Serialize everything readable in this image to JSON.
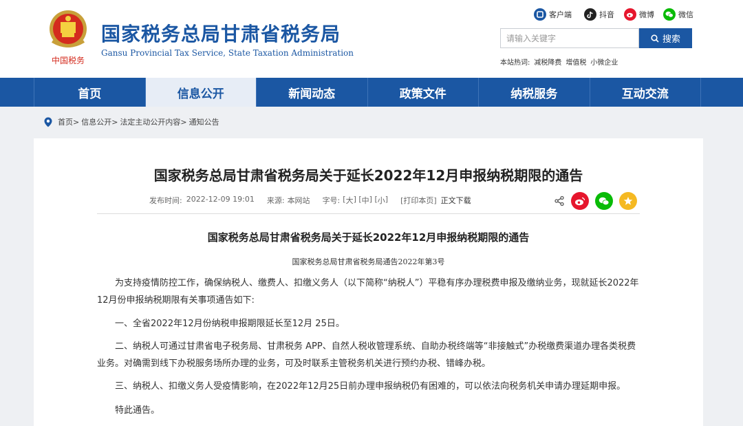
{
  "header": {
    "title_cn": "国家税务总局甘肃省税务局",
    "title_en": "Gansu Provincial Tax Service, State Taxation Administration",
    "logo_caption": "中国税务",
    "social": [
      {
        "label": "客户端",
        "icon": "client-icon",
        "color": "#1b57a3"
      },
      {
        "label": "抖音",
        "icon": "douyin-icon",
        "color": "#222222"
      },
      {
        "label": "微博",
        "icon": "weibo-icon",
        "color": "#e6162d"
      },
      {
        "label": "微信",
        "icon": "wechat-icon",
        "color": "#09bb07"
      }
    ],
    "search": {
      "placeholder": "请输入关键字",
      "button_label": "搜索"
    },
    "hot": {
      "label": "本站热词:",
      "words": [
        "减税降费",
        "增值税",
        "小微企业"
      ]
    }
  },
  "nav": {
    "items": [
      "首页",
      "信息公开",
      "新闻动态",
      "政策文件",
      "纳税服务",
      "互动交流"
    ],
    "active_index": 1
  },
  "breadcrumb": [
    "首页>",
    "信息公开>",
    "法定主动公开内容>",
    "通知公告"
  ],
  "article": {
    "title": "国家税务总局甘肃省税务局关于延长2022年12月申报纳税期限的通告",
    "meta": {
      "date_label": "发布时间:",
      "date": "2022-12-09 19:01",
      "source_label": "来源:",
      "source": "本网站",
      "font_label": "字号:",
      "font_open": "[",
      "font_large": "大",
      "font_sep1": "] [",
      "font_medium": "中",
      "font_sep2": "] [",
      "font_small": "小",
      "font_close": "]",
      "print": "[打印本页]",
      "download": "正文下载"
    },
    "doc_title": "国家税务总局甘肃省税务局关于延长2022年12月申报纳税期限的通告",
    "doc_number": "国家税务总局甘肃省税务局通告2022年第3号",
    "paragraphs": [
      "为支持疫情防控工作，确保纳税人、缴费人、扣缴义务人（以下简称“纳税人”）平稳有序办理税费申报及缴纳业务，现就延长2022年12月份申报纳税期限有关事项通告如下:",
      "一、全省2022年12月份纳税申报期限延长至12月 25日。",
      "二、纳税人可通过甘肃省电子税务局、甘肃税务 APP、自然人税收管理系统、自助办税终端等“非接触式”办税缴费渠道办理各类税费业务。对确需到线下办税服务场所办理的业务，可及时联系主管税务机关进行预约办税、错峰办税。",
      "三、纳税人、扣缴义务人受疫情影响，在2022年12月25日前办理申报纳税仍有困难的，可以依法向税务机关申请办理延期申报。",
      "特此通告。"
    ]
  },
  "colors": {
    "brand": "#1b57a3",
    "nav_active_bg": "#e7edf6",
    "weibo": "#e6162d",
    "wechat": "#09bb07",
    "favorite": "#f5b922"
  }
}
